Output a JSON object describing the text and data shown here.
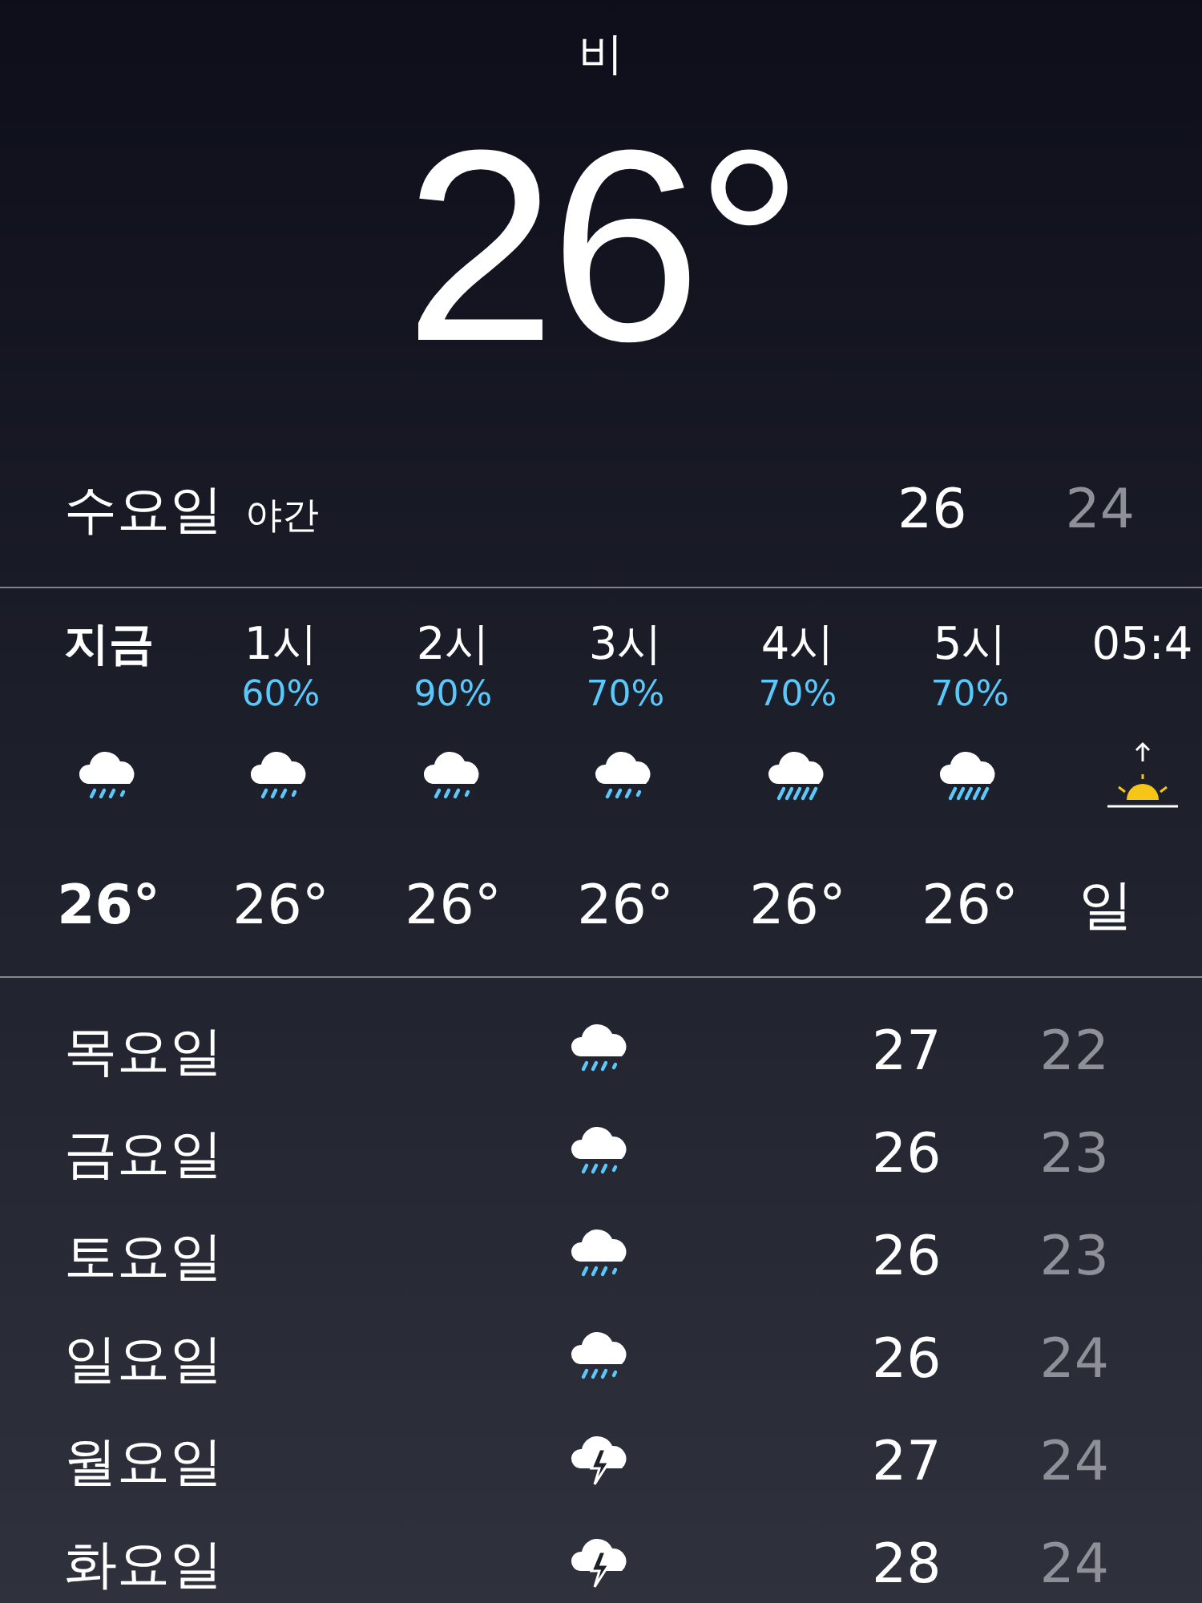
{
  "condition": "비",
  "temperature": "26°",
  "today": {
    "day": "수요일",
    "period": "야간",
    "high": "26",
    "low": "24"
  },
  "hourly": [
    {
      "time": "지금",
      "kind": "rain",
      "temp": "26°",
      "current": true
    },
    {
      "time": "1시",
      "chance": "60%",
      "kind": "rain",
      "temp": "26°",
      "current": false
    },
    {
      "time": "2시",
      "chance": "90%",
      "kind": "rain",
      "temp": "26°",
      "current": false
    },
    {
      "time": "3시",
      "chance": "70%",
      "kind": "rain",
      "temp": "26°",
      "current": false
    },
    {
      "time": "4시",
      "chance": "70%",
      "kind": "heavy-rain",
      "temp": "26°",
      "current": false
    },
    {
      "time": "5시",
      "chance": "70%",
      "kind": "heavy-rain",
      "temp": "26°",
      "current": false
    },
    {
      "time": "05:4",
      "kind": "sunrise",
      "temp": "일",
      "current": false
    }
  ],
  "daily": [
    {
      "day": "목요일",
      "kind": "rain",
      "high": "27",
      "low": "22"
    },
    {
      "day": "금요일",
      "kind": "rain",
      "high": "26",
      "low": "23"
    },
    {
      "day": "토요일",
      "kind": "rain",
      "high": "26",
      "low": "23"
    },
    {
      "day": "일요일",
      "kind": "rain",
      "high": "26",
      "low": "24"
    },
    {
      "day": "월요일",
      "kind": "thunder",
      "high": "27",
      "low": "24"
    },
    {
      "day": "화요일",
      "kind": "thunder",
      "high": "28",
      "low": "24"
    }
  ]
}
